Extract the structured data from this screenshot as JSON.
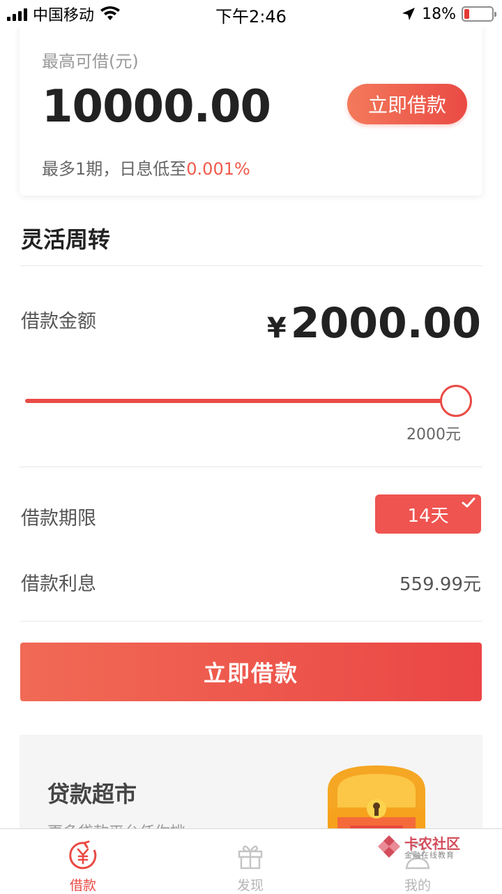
{
  "status_bar": {
    "carrier": "中国移动",
    "time": "下午2:46",
    "battery": "18%",
    "battery_level": 0.18
  },
  "credit_card": {
    "label": "最高可借(元)",
    "amount": "10000.00",
    "button": "立即借款",
    "info_prefix": "最多1期，日息低至",
    "info_rate": "0.001%"
  },
  "section": {
    "title": "灵活周转"
  },
  "loan_amount": {
    "label": "借款金额",
    "currency": "¥",
    "value": "2000.00",
    "slider_caption": "2000元",
    "slider_level": 1.0
  },
  "loan_term": {
    "label": "借款期限",
    "selected": "14天"
  },
  "interest": {
    "label": "借款利息",
    "value": "559.99元"
  },
  "main_button": {
    "label": "立即借款"
  },
  "market": {
    "title": "贷款超市",
    "subtitle": "更多贷款平台任你挑"
  },
  "tabs": [
    {
      "label": "借款",
      "icon": "yen-circle-icon",
      "active": true
    },
    {
      "label": "发现",
      "icon": "gift-icon",
      "active": false
    },
    {
      "label": "我的",
      "icon": "user-icon",
      "active": false
    }
  ],
  "watermark": {
    "name": "卡农社区",
    "sub": "金融在线教育"
  },
  "colors": {
    "accent": "#ea4a44",
    "rate_text": "#f05a4a"
  }
}
